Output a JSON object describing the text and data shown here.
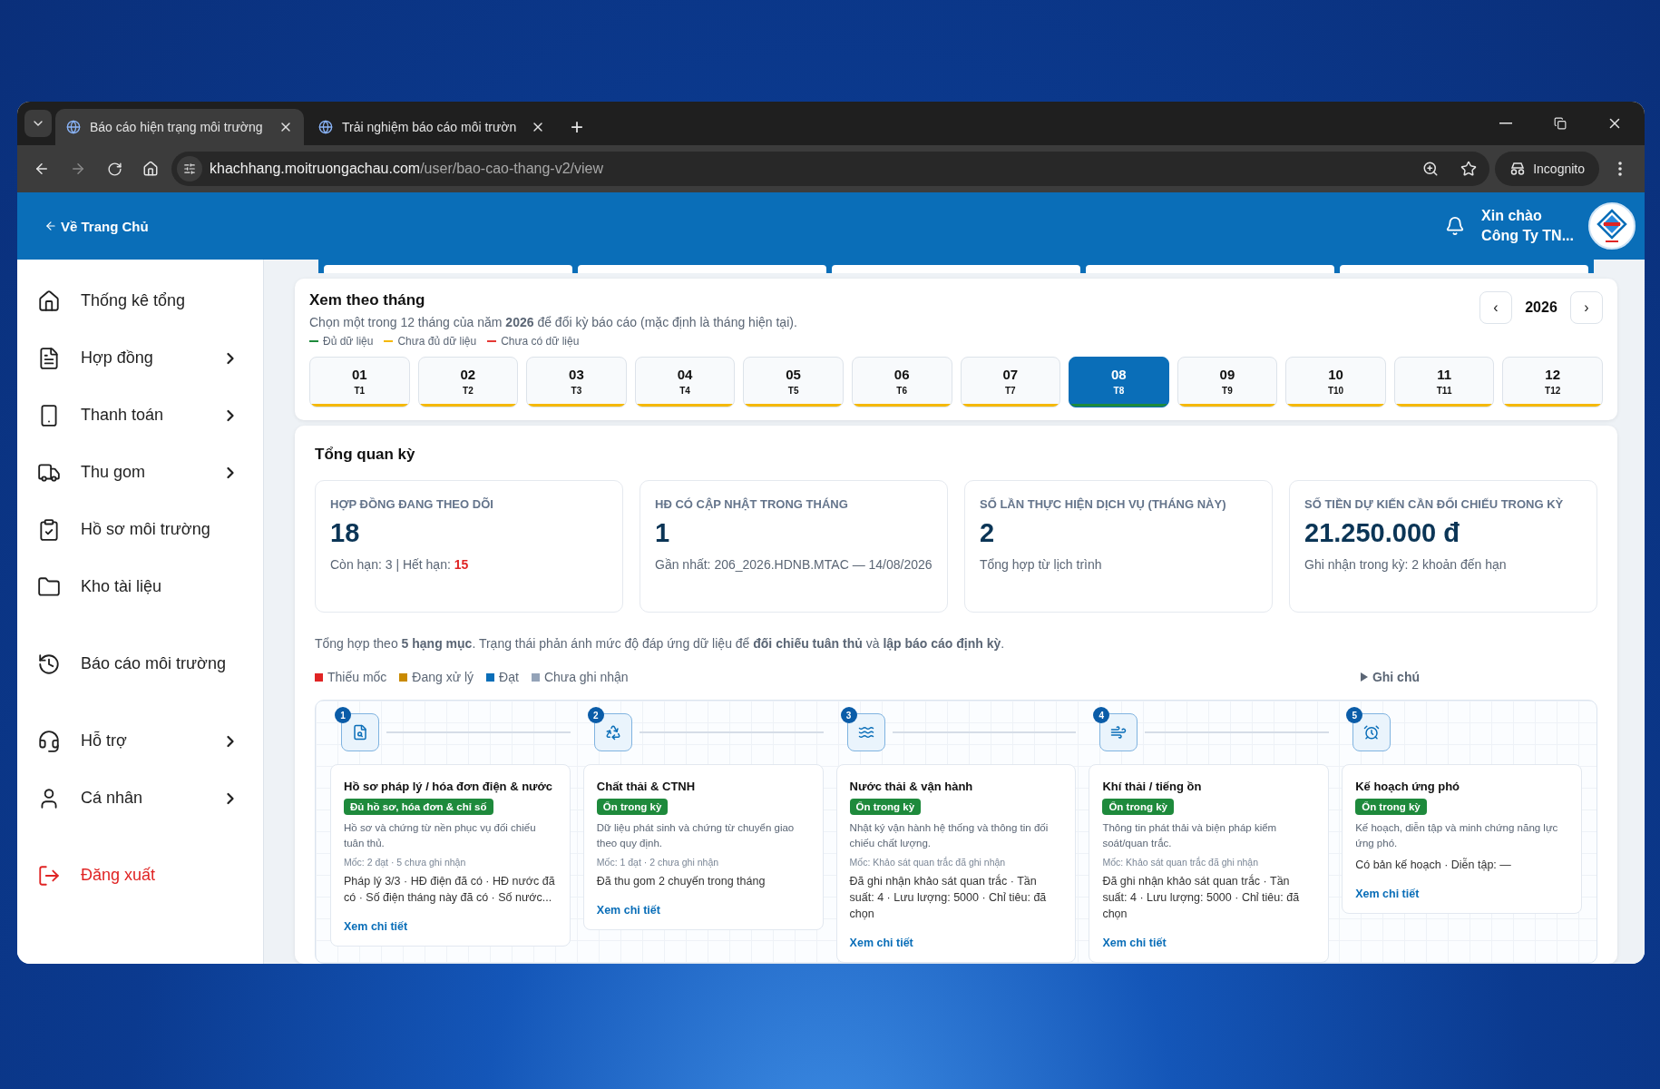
{
  "browser": {
    "tabs": [
      {
        "title": "Báo cáo hiện trạng môi trường",
        "selected": true
      },
      {
        "title": "Trải nghiệm báo cáo môi trườn",
        "selected": false
      }
    ],
    "new_tab": "+",
    "url_host": "khachhang.moitruongachau.com",
    "url_path": "/user/bao-cao-thang-v2/view",
    "profile": "Incognito"
  },
  "header": {
    "back_link": "Về Trang Chủ",
    "greeting": "Xin chào",
    "user": "Công Ty TN..."
  },
  "sidebar": {
    "groups": [
      [
        {
          "label": "Thống kê tổng",
          "expandable": false,
          "kind": "normal"
        },
        {
          "label": "Hợp đồng",
          "expandable": true,
          "kind": "normal"
        },
        {
          "label": "Thanh toán",
          "expandable": true,
          "kind": "normal"
        },
        {
          "label": "Thu gom",
          "expandable": true,
          "kind": "normal"
        },
        {
          "label": "Hồ sơ môi trường",
          "expandable": false,
          "kind": "normal"
        },
        {
          "label": "Kho tài liệu",
          "expandable": false,
          "kind": "normal"
        }
      ],
      [
        {
          "label": "Báo cáo môi trường",
          "expandable": false,
          "kind": "normal"
        }
      ],
      [
        {
          "label": "Hỗ trợ",
          "expandable": true,
          "kind": "normal"
        },
        {
          "label": "Cá nhân",
          "expandable": true,
          "kind": "normal"
        }
      ],
      [
        {
          "label": "Đăng xuất",
          "expandable": false,
          "kind": "danger"
        }
      ]
    ]
  },
  "month_picker": {
    "title": "Xem theo tháng",
    "subtitle": "Chọn một trong 12 tháng của năm **2026** để đổi kỳ báo cáo (mặc định là tháng hiện tại).",
    "year": "2026",
    "prev": "‹",
    "next": "›",
    "legend": [
      {
        "label": "Đủ dữ liệu",
        "color": "#1e8a3c"
      },
      {
        "label": "Chưa đủ dữ liệu",
        "color": "#f5b800"
      },
      {
        "label": "Chưa có dữ liệu",
        "color": "#e53935"
      }
    ],
    "months": [
      {
        "number": "01",
        "short": "T1",
        "color": "#f5b800",
        "selected": false
      },
      {
        "number": "02",
        "short": "T2",
        "color": "#f5b800",
        "selected": false
      },
      {
        "number": "03",
        "short": "T3",
        "color": "#f5b800",
        "selected": false
      },
      {
        "number": "04",
        "short": "T4",
        "color": "#f5b800",
        "selected": false
      },
      {
        "number": "05",
        "short": "T5",
        "color": "#f5b800",
        "selected": false
      },
      {
        "number": "06",
        "short": "T6",
        "color": "#f5b800",
        "selected": false
      },
      {
        "number": "07",
        "short": "T7",
        "color": "#f5b800",
        "selected": false
      },
      {
        "number": "08",
        "short": "T8",
        "color": "#1e8a3c",
        "selected": true
      },
      {
        "number": "09",
        "short": "T9",
        "color": "#f5b800",
        "selected": false
      },
      {
        "number": "10",
        "short": "T10",
        "color": "#f5b800",
        "selected": false
      },
      {
        "number": "11",
        "short": "T11",
        "color": "#f5b800",
        "selected": false
      },
      {
        "number": "12",
        "short": "T12",
        "color": "#f5b800",
        "selected": false
      }
    ]
  },
  "overview": {
    "title": "Tổng quan kỳ",
    "stats": [
      {
        "label": "HỢP ĐỒNG ĐANG THEO DÕI",
        "value": "18",
        "note": "Còn hạn: 3 | Hết hạn: ",
        "alert": "15"
      },
      {
        "label": "HĐ CÓ CẬP NHẬT TRONG THÁNG",
        "value": "1",
        "note": "Gần nhất: 206_2026.HDNB.MTAC — 14/08/2026"
      },
      {
        "label": "SỐ LẦN THỰC HIỆN DỊCH VỤ (THÁNG NÀY)",
        "value": "2",
        "note": "Tổng hợp từ lịch trình"
      },
      {
        "label": "SỐ TIỀN DỰ KIẾN CẦN ĐỐI CHIẾU TRONG KỲ",
        "value": "21.250.000 đ",
        "note": "Ghi nhận trong kỳ: 2 khoản đến hạn"
      }
    ],
    "summary": "Tổng hợp theo **5 hạng mục**. Trạng thái phản ánh mức độ đáp ứng dữ liệu để **đối chiếu tuân thủ** và **lập báo cáo định kỳ**.",
    "status_legend": [
      {
        "label": "Thiếu mốc",
        "color": "#e02424"
      },
      {
        "label": "Đang xử lý",
        "color": "#c98a00"
      },
      {
        "label": "Đạt",
        "color": "#0a6eb8"
      },
      {
        "label": "Chưa ghi nhận",
        "color": "#94a3b8"
      }
    ],
    "notes_toggle": {
      "label": "Ghi chú",
      "expanded": false
    },
    "steps": [
      {
        "number": "1",
        "title": "Hồ sơ pháp lý / hóa đơn điện & nước",
        "badge": "Đủ hồ sơ, hóa đơn & chỉ số",
        "description": "Hồ sơ và chứng từ nền phục vụ đối chiếu tuân thủ.",
        "milestone": "Mốc: 2 đạt · 5 chưa ghi nhận",
        "detail": "Pháp lý 3/3 · HĐ điện đã có · HĐ nước đã có · Số điện tháng này đã có · Số nước...",
        "link": "Xem chi tiết"
      },
      {
        "number": "2",
        "title": "Chất thải & CTNH",
        "badge": "Ổn trong kỳ",
        "description": "Dữ liệu phát sinh và chứng từ chuyển giao theo quy định.",
        "milestone": "Mốc: 1 đạt · 2 chưa ghi nhận",
        "detail": "Đã thu gom 2 chuyến trong tháng",
        "link": "Xem chi tiết"
      },
      {
        "number": "3",
        "title": "Nước thải & vận hành",
        "badge": "Ổn trong kỳ",
        "description": "Nhật ký vận hành hệ thống và thông tin đối chiếu chất lượng.",
        "milestone": "Mốc: Khảo sát quan trắc đã ghi nhận",
        "detail": "Đã ghi nhận khảo sát quan trắc · Tần suất: 4 · Lưu lượng: 5000 · Chỉ tiêu: đã chọn",
        "link": "Xem chi tiết"
      },
      {
        "number": "4",
        "title": "Khí thải / tiếng ồn",
        "badge": "Ổn trong kỳ",
        "description": "Thông tin phát thải và biện pháp kiểm soát/quan trắc.",
        "milestone": "Mốc: Khảo sát quan trắc đã ghi nhận",
        "detail": "Đã ghi nhận khảo sát quan trắc · Tần suất: 4 · Lưu lượng: 5000 · Chỉ tiêu: đã chọn",
        "link": "Xem chi tiết"
      },
      {
        "number": "5",
        "title": "Kế hoạch ứng phó",
        "badge": "Ổn trong kỳ",
        "description": "Kế hoạch, diễn tập và minh chứng năng lực ứng phó.",
        "detail": "Có bản kế hoạch · Diễn tập: —",
        "link": "Xem chi tiết"
      }
    ]
  }
}
